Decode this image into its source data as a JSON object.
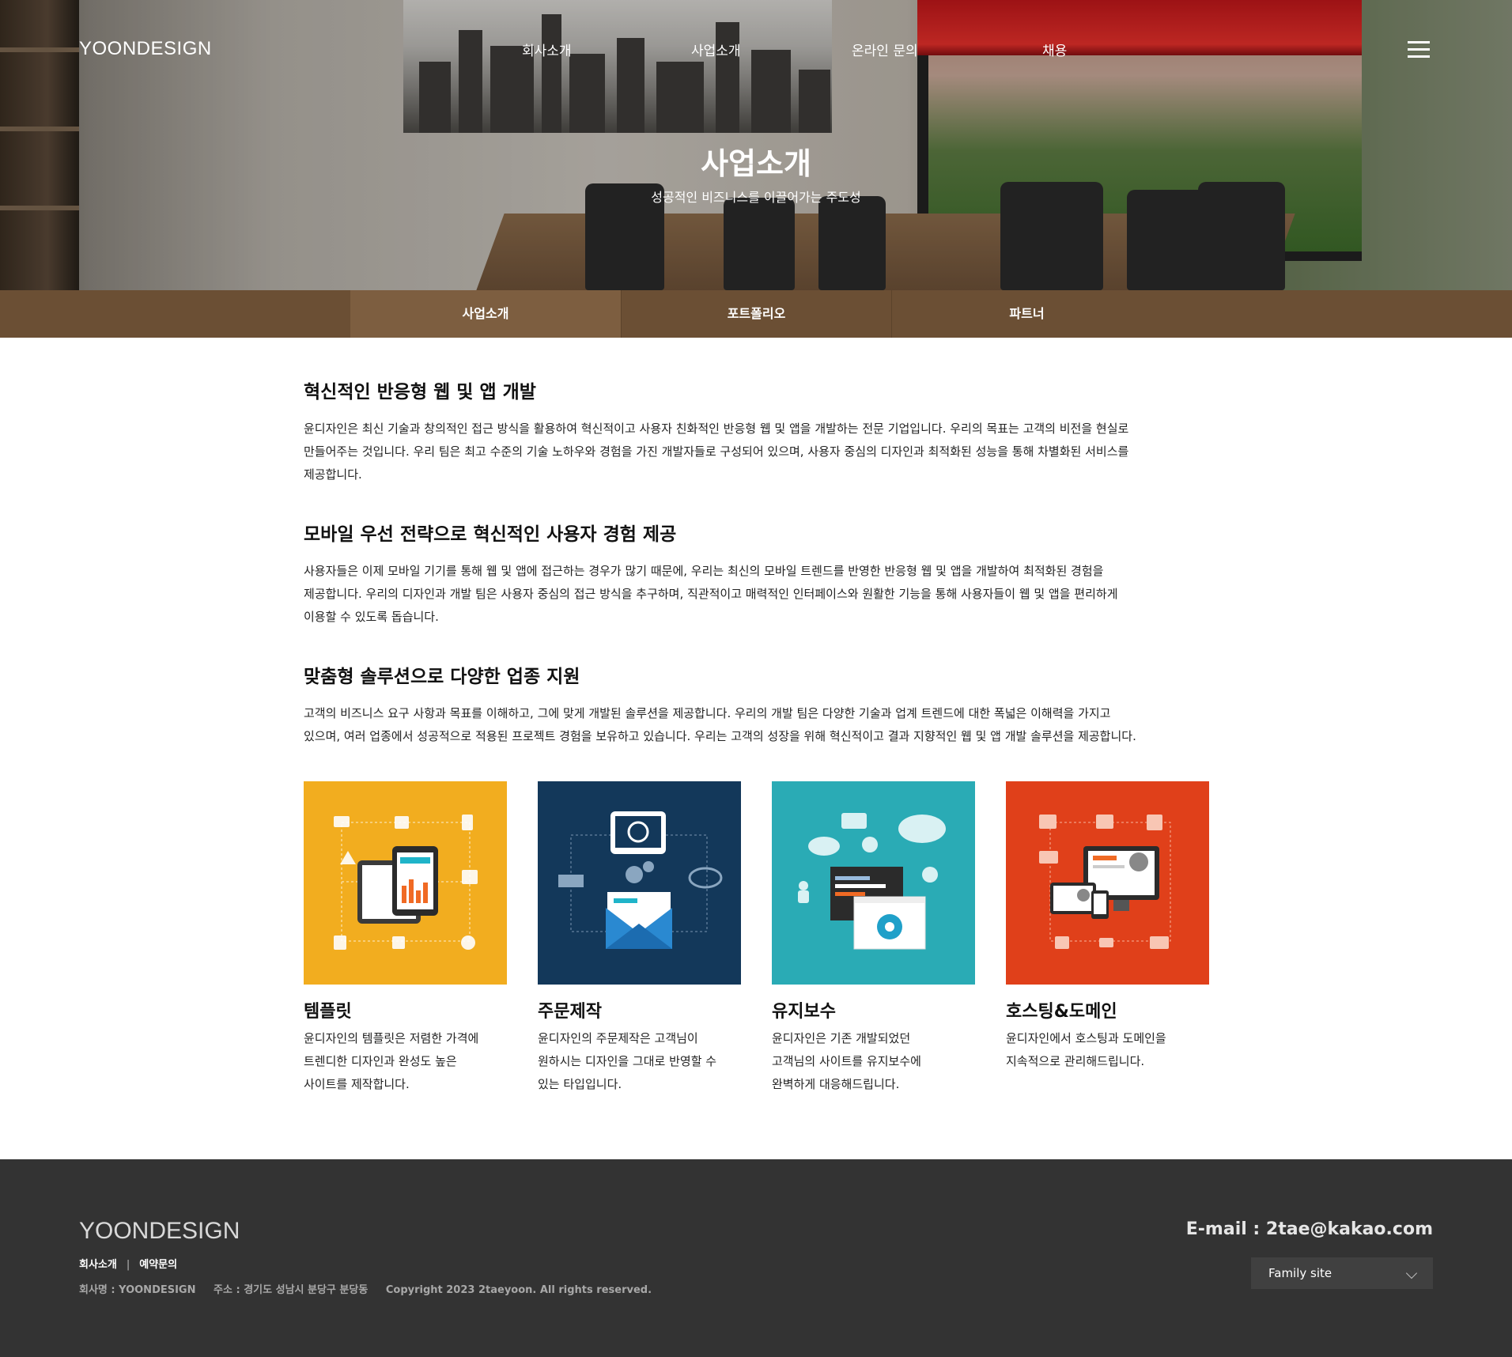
{
  "header": {
    "logo": "YOONDESIGN",
    "menu": [
      "회사소개",
      "사업소개",
      "온라인 문의",
      "채용"
    ]
  },
  "hero": {
    "title": "사업소개",
    "subtitle": "성공적인 비즈니스를 이끌어가는 주도성"
  },
  "subnav": {
    "tabs": [
      "사업소개",
      "포트폴리오",
      "파트너"
    ],
    "active": 0
  },
  "sections": [
    {
      "title": "혁신적인 반응형 웹 및 앱 개발",
      "lines": [
        "윤디자인은 최신 기술과 창의적인 접근 방식을 활용하여 혁신적이고 사용자 친화적인 반응형 웹 및 앱을 개발하는 전문 기업입니다. 우리의 목표는 고객의 비전을 현실로",
        "만들어주는 것입니다. 우리 팀은 최고 수준의 기술 노하우와 경험을 가진 개발자들로 구성되어 있으며, 사용자 중심의 디자인과 최적화된 성능을 통해 차별화된 서비스를",
        "제공합니다."
      ]
    },
    {
      "title": "모바일 우선 전략으로 혁신적인 사용자 경험 제공",
      "lines": [
        "사용자들은 이제 모바일 기기를 통해 웹 및 앱에 접근하는 경우가 많기 때문에, 우리는 최신의 모바일 트렌드를 반영한 반응형 웹 및 앱을 개발하여 최적화된 경험을",
        "제공합니다. 우리의 디자인과 개발 팀은 사용자 중심의 접근 방식을 추구하며, 직관적이고 매력적인 인터페이스와 원활한 기능을 통해 사용자들이 웹 및 앱을 편리하게",
        "이용할 수 있도록 돕습니다."
      ]
    },
    {
      "title": "맞춤형 솔루션으로 다양한 업종 지원",
      "lines": [
        "고객의 비즈니스 요구 사항과 목표를 이해하고, 그에 맞게 개발된 솔루션을 제공합니다. 우리의 개발 팀은 다양한 기술과 업계 트렌드에 대한 폭넓은 이해력을 가지고",
        "있으며, 여러 업종에서 성공적으로 적용된 프로젝트 경험을 보유하고 있습니다. 우리는 고객의 성장을 위해 혁신적이고 결과 지향적인 웹 및 앱 개발 솔루션을 제공합니다."
      ]
    }
  ],
  "services": [
    {
      "title": "템플릿",
      "color": "#f2ad1f",
      "icon": "tablet-dashboard-icon",
      "lines": [
        "윤디자인의 템플릿은 저렴한 가격에",
        "트렌디한 디자인과 완성도 높은",
        "사이트를 제작합니다."
      ]
    },
    {
      "title": "주문제작",
      "color": "#13385a",
      "icon": "mail-gear-icon",
      "lines": [
        "윤디자인의 주문제작은 고객님이",
        "원하시는 디자인을 그대로 반영할 수",
        "있는 타입입니다."
      ]
    },
    {
      "title": "유지보수",
      "color": "#2aabb5",
      "icon": "cloud-browser-icon",
      "lines": [
        "윤디자인은 기존 개발되었던",
        "고객님의 사이트를 유지보수에",
        "완벽하게 대응해드립니다."
      ]
    },
    {
      "title": "호스팅&도메인",
      "color": "#e0401a",
      "icon": "devices-network-icon",
      "lines": [
        "윤디자인에서 호스팅과 도메인을",
        "지속적으로 관리해드립니다."
      ]
    }
  ],
  "footer": {
    "logo": "YOONDESIGN",
    "links": [
      "회사소개",
      "예약문의"
    ],
    "company": "회사명 : YOONDESIGN",
    "address": "주소 : 경기도 성남시 분당구 분당동",
    "copyright": "Copyright 2023 2taeyoon. All rights reserved.",
    "email": "E-mail : 2tae@kakao.com",
    "family_site": "Family site"
  }
}
